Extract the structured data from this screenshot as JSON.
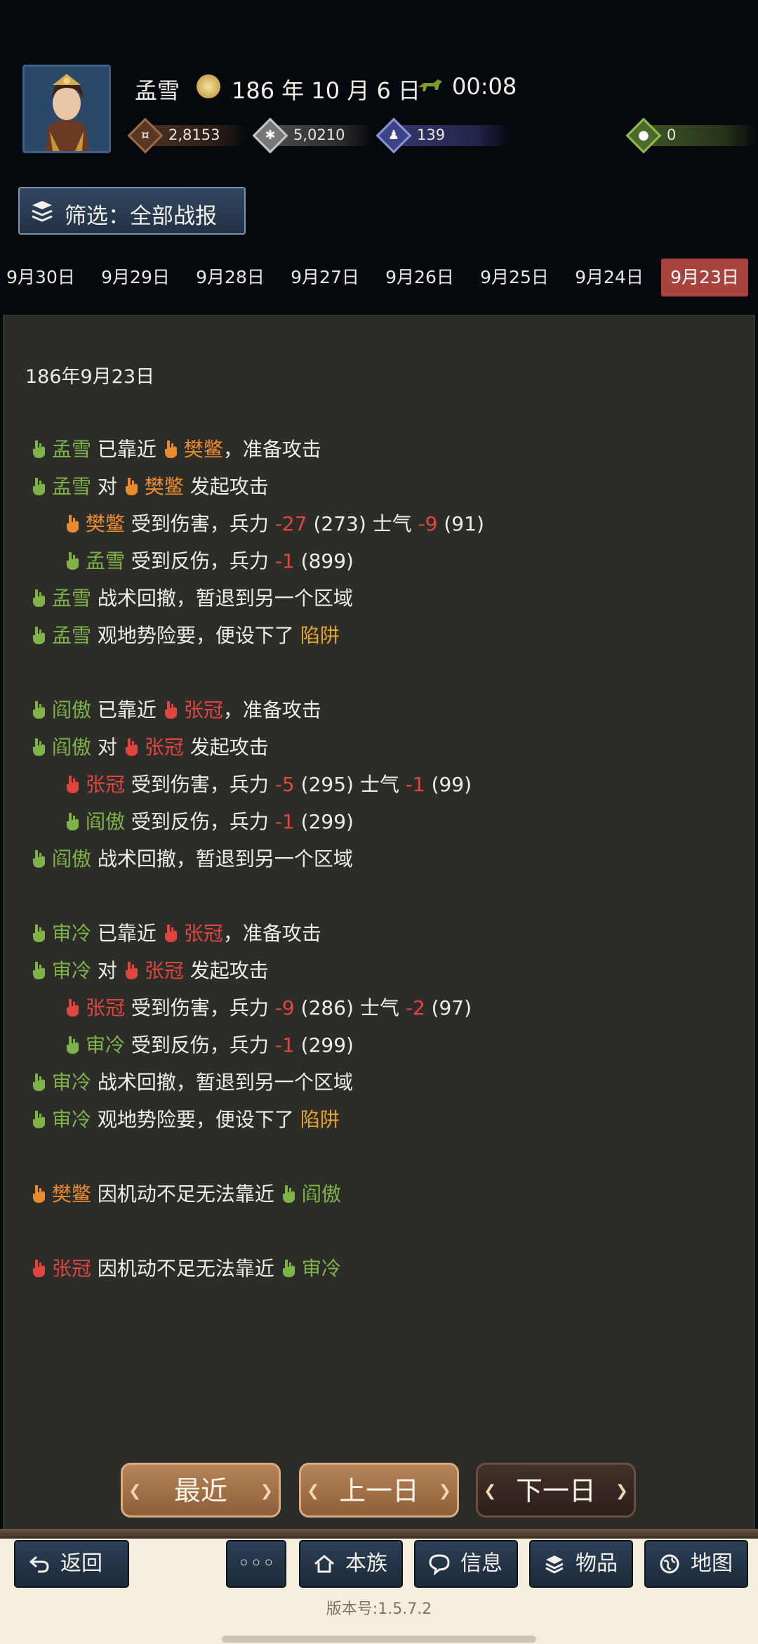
{
  "header": {
    "name": "孟雪",
    "date": "186 年 10 月 6 日",
    "time": "00:08",
    "resources": [
      {
        "icon": "coin-icon",
        "value": "2,8153"
      },
      {
        "icon": "grain-icon",
        "value": "5,0210"
      },
      {
        "icon": "soldier-icon",
        "value": "139"
      },
      {
        "icon": "bag-icon",
        "value": "0"
      }
    ]
  },
  "filter": {
    "label": "筛选：全部战报"
  },
  "tabs": [
    "9月30日",
    "9月29日",
    "9月28日",
    "9月27日",
    "9月26日",
    "9月25日",
    "9月24日",
    "9月23日"
  ],
  "active_tab": "9月23日",
  "log": {
    "date": "186年9月23日",
    "lines": [
      {
        "indent": 0,
        "parts": [
          {
            "t": "孟雪",
            "c": "g",
            "ic": "g"
          },
          {
            "t": " 已靠近 "
          },
          {
            "t": "樊鳖",
            "c": "o",
            "ic": "o"
          },
          {
            "t": "，准备攻击"
          }
        ]
      },
      {
        "indent": 0,
        "parts": [
          {
            "t": "孟雪",
            "c": "g",
            "ic": "g"
          },
          {
            "t": " 对 "
          },
          {
            "t": "樊鳖",
            "c": "o",
            "ic": "o"
          },
          {
            "t": " 发起攻击"
          }
        ]
      },
      {
        "indent": 1,
        "parts": [
          {
            "t": "樊鳖",
            "c": "o",
            "ic": "o"
          },
          {
            "t": " 受到伤害，兵力 "
          },
          {
            "t": "-27",
            "c": "r"
          },
          {
            "t": " (273) 士气 "
          },
          {
            "t": "-9",
            "c": "r"
          },
          {
            "t": " (91)"
          }
        ]
      },
      {
        "indent": 1,
        "parts": [
          {
            "t": "孟雪",
            "c": "g",
            "ic": "g"
          },
          {
            "t": " 受到反伤，兵力 "
          },
          {
            "t": "-1",
            "c": "r"
          },
          {
            "t": " (899)"
          }
        ]
      },
      {
        "indent": 0,
        "parts": [
          {
            "t": "孟雪",
            "c": "g",
            "ic": "g"
          },
          {
            "t": " 战术回撤，暂退到另一个区域"
          }
        ]
      },
      {
        "indent": 0,
        "parts": [
          {
            "t": "孟雪",
            "c": "g",
            "ic": "g"
          },
          {
            "t": " 观地势险要，便设下了 "
          },
          {
            "t": "陷阱",
            "c": "y"
          }
        ]
      },
      {
        "indent": 0,
        "parts": [
          {
            "t": "阎傲",
            "c": "g",
            "ic": "g"
          },
          {
            "t": " 已靠近 "
          },
          {
            "t": "张冠",
            "c": "r",
            "ic": "r"
          },
          {
            "t": "，准备攻击"
          }
        ]
      },
      {
        "indent": 0,
        "parts": [
          {
            "t": "阎傲",
            "c": "g",
            "ic": "g"
          },
          {
            "t": " 对 "
          },
          {
            "t": "张冠",
            "c": "r",
            "ic": "r"
          },
          {
            "t": " 发起攻击"
          }
        ]
      },
      {
        "indent": 1,
        "parts": [
          {
            "t": "张冠",
            "c": "r",
            "ic": "r"
          },
          {
            "t": " 受到伤害，兵力 "
          },
          {
            "t": "-5",
            "c": "r"
          },
          {
            "t": " (295) 士气 "
          },
          {
            "t": "-1",
            "c": "r"
          },
          {
            "t": " (99)"
          }
        ]
      },
      {
        "indent": 1,
        "parts": [
          {
            "t": "阎傲",
            "c": "g",
            "ic": "g"
          },
          {
            "t": " 受到反伤，兵力 "
          },
          {
            "t": "-1",
            "c": "r"
          },
          {
            "t": " (299)"
          }
        ]
      },
      {
        "indent": 0,
        "parts": [
          {
            "t": "阎傲",
            "c": "g",
            "ic": "g"
          },
          {
            "t": " 战术回撤，暂退到另一个区域"
          }
        ]
      },
      {
        "indent": 0,
        "parts": [
          {
            "t": "审冷",
            "c": "g",
            "ic": "g"
          },
          {
            "t": " 已靠近 "
          },
          {
            "t": "张冠",
            "c": "r",
            "ic": "r"
          },
          {
            "t": "，准备攻击"
          }
        ]
      },
      {
        "indent": 0,
        "parts": [
          {
            "t": "审冷",
            "c": "g",
            "ic": "g"
          },
          {
            "t": " 对 "
          },
          {
            "t": "张冠",
            "c": "r",
            "ic": "r"
          },
          {
            "t": " 发起攻击"
          }
        ]
      },
      {
        "indent": 1,
        "parts": [
          {
            "t": "张冠",
            "c": "r",
            "ic": "r"
          },
          {
            "t": " 受到伤害，兵力 "
          },
          {
            "t": "-9",
            "c": "r"
          },
          {
            "t": " (286) 士气 "
          },
          {
            "t": "-2",
            "c": "r"
          },
          {
            "t": " (97)"
          }
        ]
      },
      {
        "indent": 1,
        "parts": [
          {
            "t": "审冷",
            "c": "g",
            "ic": "g"
          },
          {
            "t": " 受到反伤，兵力 "
          },
          {
            "t": "-1",
            "c": "r"
          },
          {
            "t": " (299)"
          }
        ]
      },
      {
        "indent": 0,
        "parts": [
          {
            "t": "审冷",
            "c": "g",
            "ic": "g"
          },
          {
            "t": " 战术回撤，暂退到另一个区域"
          }
        ]
      },
      {
        "indent": 0,
        "parts": [
          {
            "t": "审冷",
            "c": "g",
            "ic": "g"
          },
          {
            "t": " 观地势险要，便设下了 "
          },
          {
            "t": "陷阱",
            "c": "y"
          }
        ]
      },
      {
        "indent": 0,
        "parts": [
          {
            "t": "樊鳖",
            "c": "o",
            "ic": "o"
          },
          {
            "t": " 因机动不足无法靠近 "
          },
          {
            "t": "阎傲",
            "c": "g",
            "ic": "g"
          }
        ]
      },
      {
        "indent": 0,
        "parts": [
          {
            "t": "张冠",
            "c": "r",
            "ic": "r"
          },
          {
            "t": " 因机动不足无法靠近 "
          },
          {
            "t": "审冷",
            "c": "g",
            "ic": "g"
          }
        ]
      }
    ]
  },
  "day_buttons": {
    "recent": "最近",
    "prev": "上一日",
    "next": "下一日"
  },
  "nav": {
    "back": "返回",
    "more": "◦◦◦",
    "clan": "本族",
    "info": "信息",
    "items": "物品",
    "map": "地图"
  },
  "version": "版本号:1.5.7.2",
  "colors": {
    "green": "#7fb347",
    "orange": "#e98b2f",
    "red": "#e0463f",
    "yellow": "#e7a42a",
    "active_tab": "#a8433e"
  }
}
